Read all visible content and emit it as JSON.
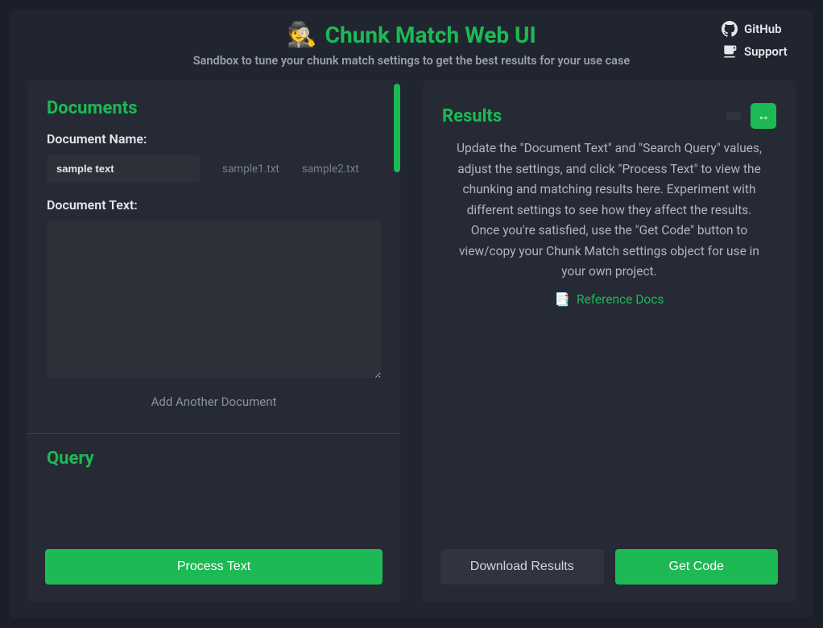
{
  "header": {
    "emoji": "🕵️",
    "title": "Chunk Match Web UI",
    "subtitle": "Sandbox to tune your chunk match settings to get the best results for your use case",
    "github_label": "GitHub",
    "support_label": "Support"
  },
  "documents": {
    "title": "Documents",
    "name_label": "Document Name:",
    "name_value": "sample text",
    "sample_files": [
      "sample1.txt",
      "sample2.txt"
    ],
    "text_label": "Document Text:",
    "text_value": "",
    "add_another_label": "Add Another Document"
  },
  "query": {
    "title": "Query"
  },
  "process_button": "Process Text",
  "results": {
    "title": "Results",
    "placeholder_message": "Update the \"Document Text\" and \"Search Query\" values, adjust the settings, and click \"Process Text\" to view the chunking and matching results here. Experiment with different settings to see how they affect the results. Once you're satisfied, use the \"Get Code\" button to view/copy your Chunk Match settings object for use in your own project.",
    "reference_docs_label": "Reference Docs",
    "reference_docs_icon": "📑",
    "download_button": "Download Results",
    "get_code_button": "Get Code",
    "expand_icon": "↔"
  }
}
